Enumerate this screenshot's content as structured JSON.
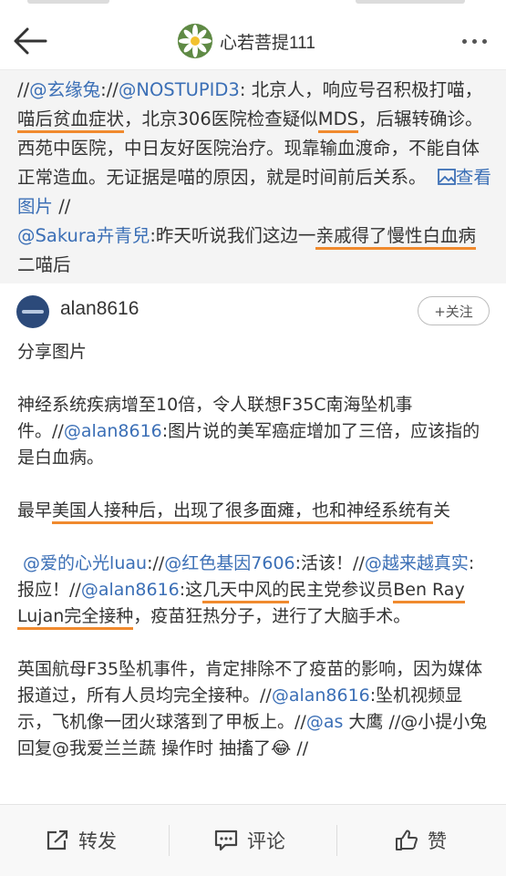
{
  "header": {
    "title": "心若菩提111"
  },
  "repost": {
    "t1": "//",
    "m1": "@玄缘兔",
    "t2": "://",
    "m2": "@NOSTUPID3",
    "t3": ": 北京人，响应号召积极打喵，",
    "h1": "喵后贫血症状",
    "t4": "，北京306医院检查疑似",
    "h2": "MDS",
    "t5": "，后辗转确诊。西苑中医院，中日友好医院治疗。现靠输血渡命，不能自体正常造血。无证据是喵的原因，就是时间前后关系。",
    "view_image": "查看图片",
    "t6": " //",
    "m3": "@Sakura卉青兒",
    "t7": ":昨天听说我们这边一",
    "h3": "亲戚得了慢性白血病二喵后"
  },
  "post": {
    "username": "alan8616",
    "follow_label": "+关注",
    "share_label": "分享图片",
    "p1a": "神经系统疾病增至10倍，令人联想F35C南海坠机事件。//",
    "p1m": "@alan8616",
    "p1b": ":图片说的美军癌症增加了三倍，应该指的是白血病。",
    "p2a": "最早",
    "p2h": "美国人接种后，出现了很多面瘫，也和神经系统有",
    "p2b": "关",
    "p3m1": "@爱的心光luau",
    "p3a": "://",
    "p3m2": "@红色基因7606",
    "p3b": ":活该！//",
    "p3m3": "@越来越真实",
    "p3c": ":报应！//",
    "p3m4": "@alan8616",
    "p3d": ":这",
    "p3h1": "几天中风的",
    "p3e": "民主党参议员",
    "p3h2": "Ben Ray Lujan完全接种",
    "p3f": "，疫苗狂热分子，进行了大脑手术。",
    "p4a": "英国航母F35坠机事件，肯定排除不了疫苗的影响，因为媒体报道过，所有人员均完全接种。//",
    "p4m1": "@alan8616",
    "p4b": ":坠机视频显示，飞机像一团火球落到了甲板上。//",
    "p4m2": "@as",
    "p4cut": "大鹰 //@小提小兔 回复@我爱兰兰蔬 操作时 抽搐了😂 //"
  },
  "toolbar": {
    "repost_label": "转发",
    "comment_label": "评论",
    "like_label": "赞"
  },
  "icons": {
    "back": "back-arrow-icon",
    "more": "more-dots-icon",
    "image": "image-icon",
    "repost": "share-icon",
    "comment": "comment-icon",
    "like": "thumbs-up-icon"
  },
  "colors": {
    "link": "#3b6fb6",
    "highlight_underline": "#f08a2e",
    "repost_background": "#f4f4f4"
  }
}
